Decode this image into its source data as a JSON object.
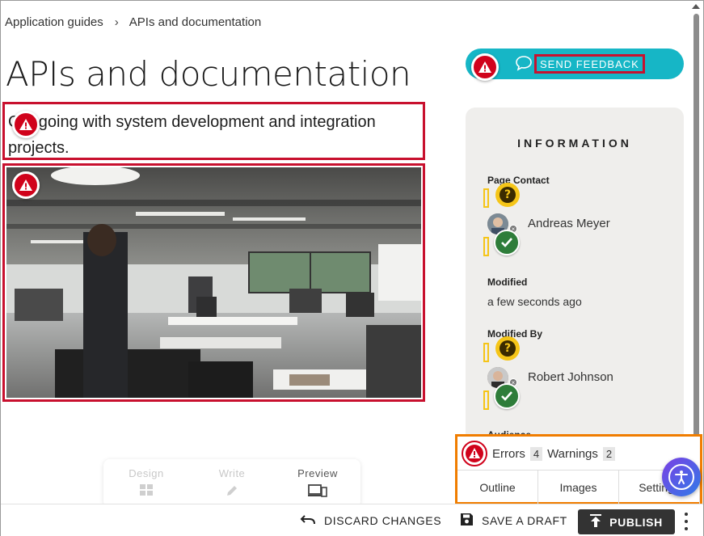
{
  "breadcrumb": {
    "items": [
      "Application guides",
      "APIs and documentation"
    ],
    "separator": "›"
  },
  "page": {
    "title": "APIs and documentation",
    "subtitle": "Get going with system development and integration projects."
  },
  "feedback": {
    "label": "SEND FEEDBACK",
    "icon": "chat-bubble-icon"
  },
  "info": {
    "title": "INFORMATION",
    "page_contact_label": "Page Contact",
    "page_contact_name": "Andreas Meyer",
    "modified_label": "Modified",
    "modified_value": "a few seconds ago",
    "modified_by_label": "Modified By",
    "modified_by_name": "Robert Johnson",
    "audience_label": "Audience"
  },
  "checker": {
    "errors_label": "Errors",
    "errors_count": "4",
    "warnings_label": "Warnings",
    "warnings_count": "2",
    "tabs": [
      "Outline",
      "Images",
      "Settings"
    ]
  },
  "modes": [
    {
      "label": "Design",
      "icon": "grid-icon",
      "state": "disabled"
    },
    {
      "label": "Write",
      "icon": "pencil-icon",
      "state": "disabled"
    },
    {
      "label": "Preview",
      "icon": "devices-icon",
      "state": "active"
    }
  ],
  "toolbar": {
    "discard_label": "DISCARD CHANGES",
    "save_label": "SAVE A DRAFT",
    "publish_label": "PUBLISH"
  },
  "colors": {
    "error_red": "#d0021b",
    "accent_teal": "#16b6c6",
    "warning_yellow": "#f5c518",
    "success_green": "#2e7d3a",
    "checker_orange": "#f07d00"
  }
}
